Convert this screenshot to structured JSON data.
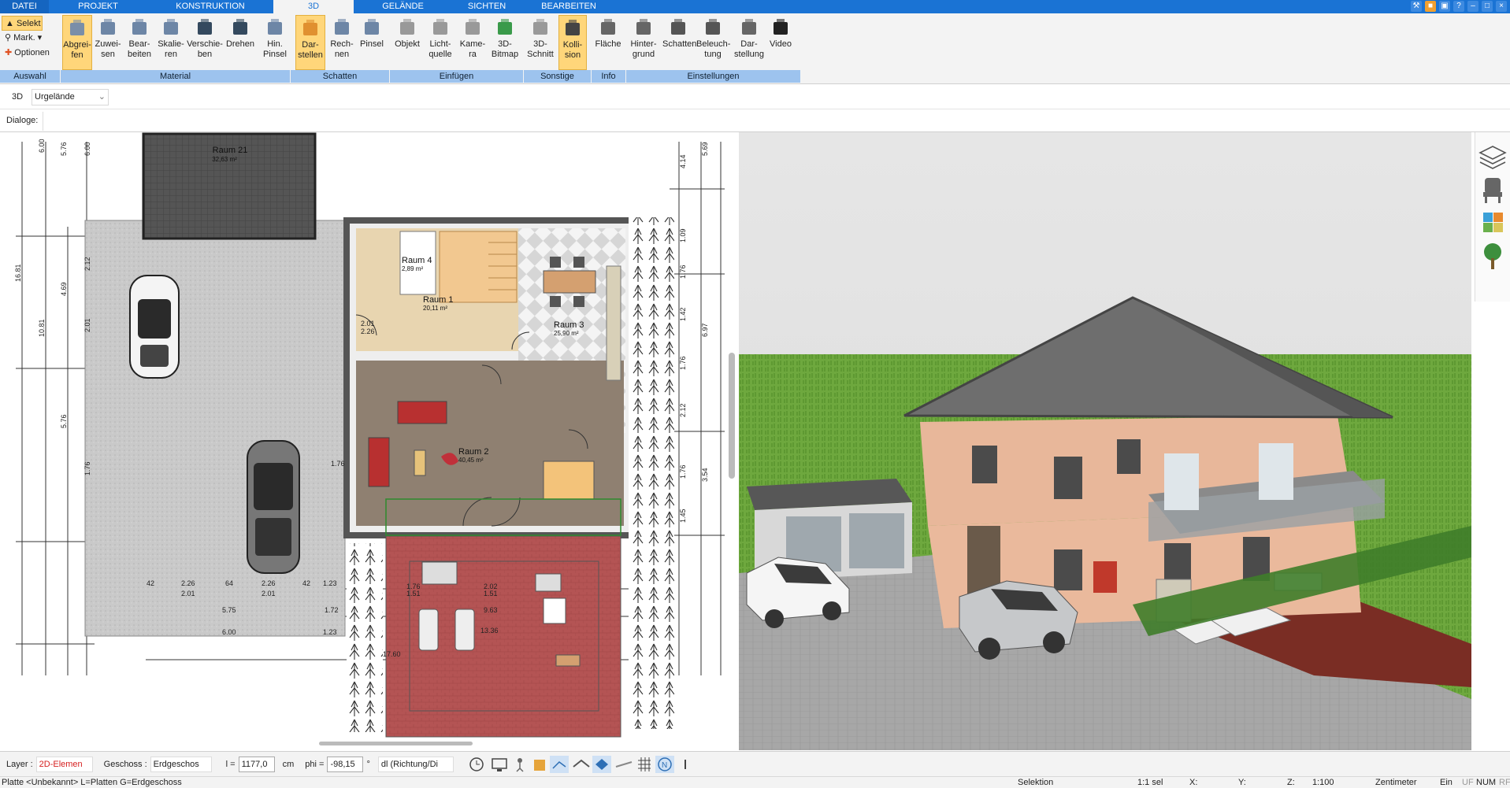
{
  "menu": {
    "tabs": [
      {
        "label": "DATEI"
      },
      {
        "label": "PROJEKT"
      },
      {
        "label": "KONSTRUKTION"
      },
      {
        "label": "3D"
      },
      {
        "label": "GELÄNDE"
      },
      {
        "label": "SICHTEN"
      },
      {
        "label": "BEARBEITEN"
      }
    ]
  },
  "ribbon": {
    "auswahl": {
      "selekt": "Selekt",
      "mark": "Mark.",
      "optionen": "Optionen"
    },
    "buttons": [
      {
        "label": "Abgrei-\nfen"
      },
      {
        "label": "Zuwei-\nsen"
      },
      {
        "label": "Bear-\nbeiten"
      },
      {
        "label": "Skalie-\nren"
      },
      {
        "label": "Verschie-\nben"
      },
      {
        "label": "Drehen"
      },
      {
        "label": "Hin.\nPinsel"
      },
      {
        "label": "Dar-\nstellen"
      },
      {
        "label": "Rech-\nnen"
      },
      {
        "label": "Pinsel"
      },
      {
        "label": "Objekt"
      },
      {
        "label": "Licht-\nquelle"
      },
      {
        "label": "Kame-\nra"
      },
      {
        "label": "3D-\nBitmap"
      },
      {
        "label": "3D-\nSchnitt"
      },
      {
        "label": "Kolli-\nsion"
      },
      {
        "label": "Fläche"
      },
      {
        "label": "Hinter-\ngrund"
      },
      {
        "label": "Schatten"
      },
      {
        "label": "Beleuch-\ntung"
      },
      {
        "label": "Dar-\nstellung"
      },
      {
        "label": "Video"
      }
    ],
    "groups": [
      {
        "label": "Auswahl"
      },
      {
        "label": "Material"
      },
      {
        "label": "Schatten"
      },
      {
        "label": "Einfügen"
      },
      {
        "label": "Sonstige"
      },
      {
        "label": "Info"
      },
      {
        "label": "Einstellungen"
      }
    ]
  },
  "subbar": {
    "view_label": "3D",
    "terrain_value": "Urgelände"
  },
  "dialog_bar": {
    "label": "Dialoge:"
  },
  "plan": {
    "rooms": [
      {
        "name": "Raum 21",
        "area": "32,63 m²"
      },
      {
        "name": "Raum 4",
        "area": "2,89 m²"
      },
      {
        "name": "Raum 1",
        "area": "20,11 m²"
      },
      {
        "name": "Raum 3",
        "area": "25,90 m²"
      },
      {
        "name": "Raum 2",
        "area": "40,45 m²"
      }
    ],
    "dims_left": [
      "6.00",
      "5.76",
      "6.00",
      "16.81",
      "10.81",
      "2.12",
      "4.69",
      "2.01",
      "5.76",
      "1.76"
    ],
    "dims_bottom": [
      "42",
      "2.26",
      "64",
      "2.26",
      "42",
      "1.23",
      "2.01",
      "2.01",
      "5.75",
      "1.72",
      "6.00",
      "1.23"
    ],
    "dims_right": [
      "4.14",
      "5.69",
      "1.09",
      "1.76",
      "1.42",
      "6.97",
      "1.76",
      "2.12",
      "1.76",
      "3.54",
      "1.45"
    ],
    "dims_misc": [
      "1.76",
      "1.51",
      "2.02",
      "1.51",
      "9.63",
      "13.36",
      "17.60",
      "2.01",
      "2.26",
      "1.76"
    ]
  },
  "status_bar": {
    "layer_label": "Layer :",
    "layer_value": "2D-Elemen",
    "geschoss_label": "Geschoss :",
    "geschoss_value": "Erdgeschos",
    "l_label": "l =",
    "l_value": "1177,0",
    "l_unit": "cm",
    "phi_label": "phi =",
    "phi_value": "-98,15",
    "phi_unit": "°",
    "dl_value": "dl (Richtung/Di"
  },
  "info_bar": {
    "left": "Platte <Unbekannt> L=Platten G=Erdgeschoss",
    "selektion": "Selektion",
    "sel_count": "1:1 sel",
    "x": "X:",
    "y": "Y:",
    "z": "Z:",
    "scale": "1:100",
    "unit": "Zentimeter",
    "ein": "Ein",
    "uf": "UF",
    "num": "NUM",
    "rf": "RF"
  },
  "colors": {
    "menu_blue": "#1a73d4",
    "ribbon_bg": "#f3f3f3",
    "group_bar": "#9dc3ee",
    "highlight": "#ffd67a",
    "layer_red": "#d62020"
  },
  "icons": [
    "layers-icon",
    "furniture-icon",
    "material-icon",
    "tree-icon",
    "clock-icon",
    "monitor-icon",
    "grid-icon",
    "north-icon"
  ]
}
